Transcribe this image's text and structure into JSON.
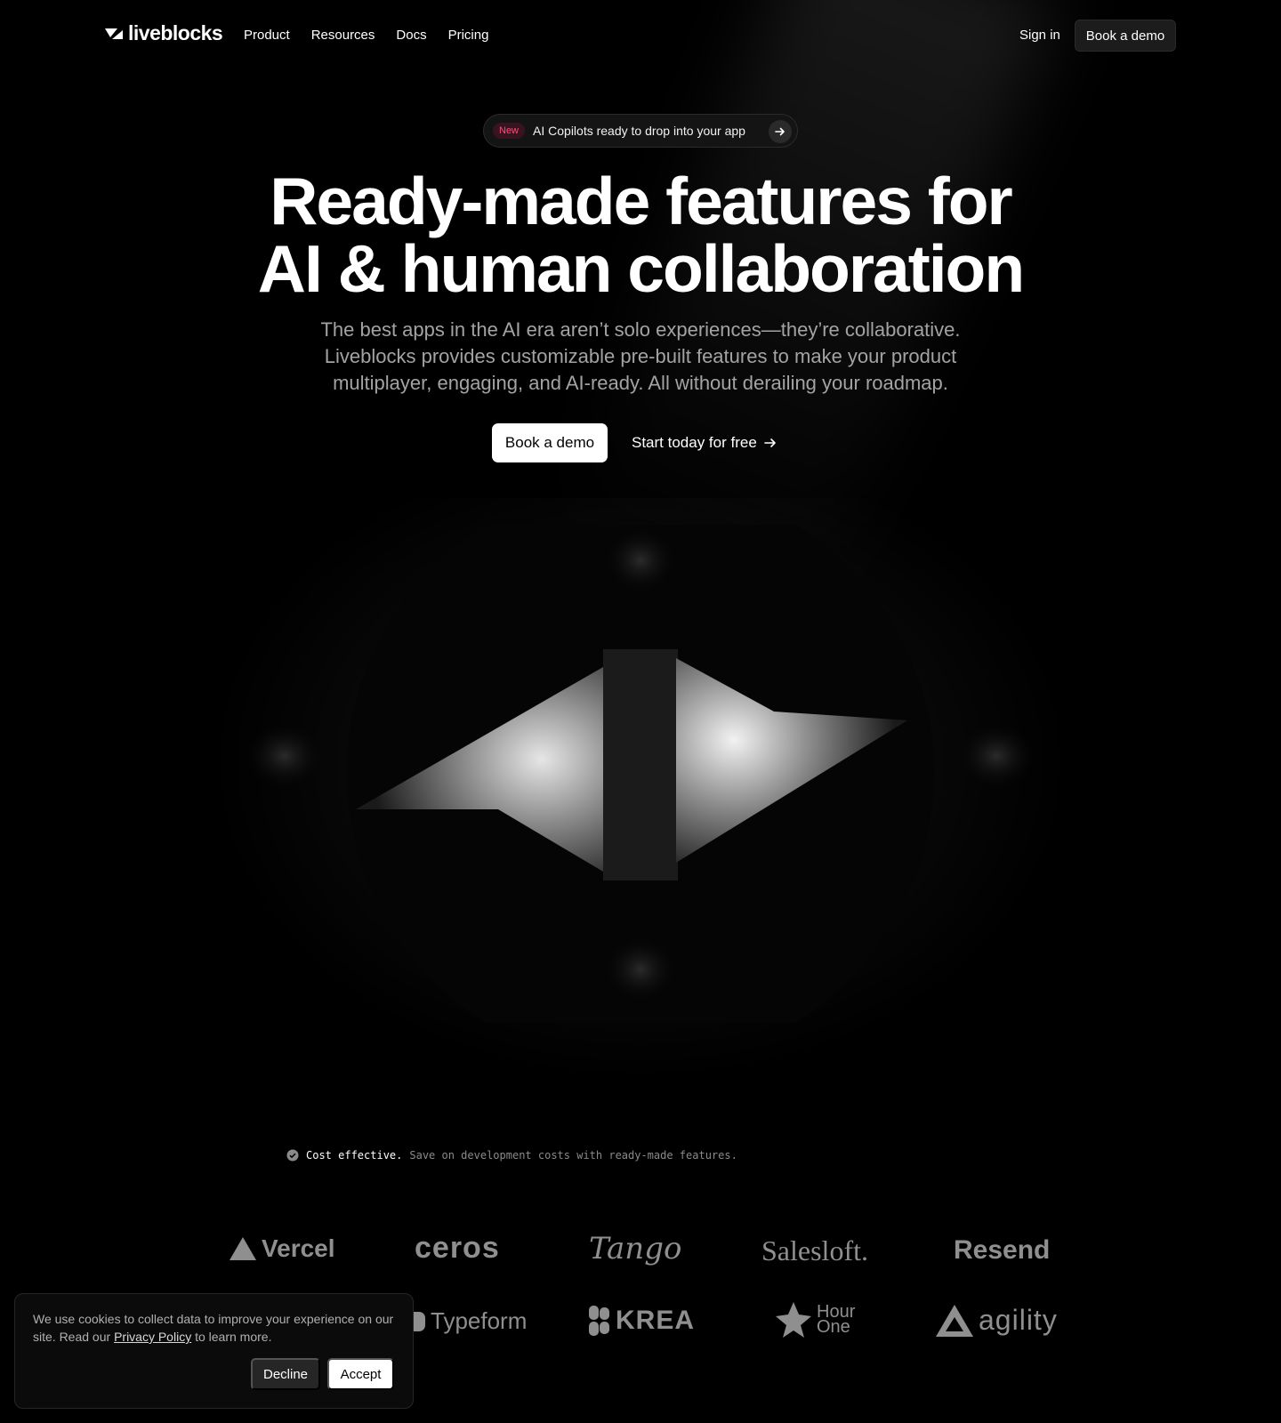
{
  "brand": {
    "name": "liveblocks"
  },
  "nav": {
    "links": [
      "Product",
      "Resources",
      "Docs",
      "Pricing"
    ],
    "signin": "Sign in",
    "cta": "Book a demo"
  },
  "announcement": {
    "badge": "New",
    "text": "AI Copilots ready to drop into your app"
  },
  "hero": {
    "title_line1": "Ready-made features for",
    "title_line2": "AI & human collaboration",
    "subtitle_line1": "The best apps in the AI era aren’t solo experiences—they’re collaborative.",
    "subtitle_line2": "Liveblocks provides customizable pre-built features to make your product",
    "subtitle_line3": "multiplayer, engaging, and AI-ready. All without derailing your roadmap.",
    "primary_cta": "Book a demo",
    "secondary_cta": "Start today for free"
  },
  "highlight": {
    "strong": "Cost effective.",
    "rest": "Save on development costs with ready-made features."
  },
  "customers": {
    "row1": [
      "Vercel",
      "ceros",
      "Tango",
      "Salesloft.",
      "Resend"
    ],
    "row2": [
      "Typeform",
      "KREA",
      "Hour",
      "One",
      "agility"
    ]
  },
  "cookie": {
    "text_before": "We use cookies to collect data to improve your experience on our site. Read our ",
    "link": "Privacy Policy",
    "text_after": " to learn more.",
    "decline": "Decline",
    "accept": "Accept"
  },
  "colors": {
    "background": "#000000",
    "badge_text": "#ff4d7a",
    "badge_bg": "#3a1320",
    "muted_text": "#a3a3a3",
    "logo_gray": "#8f8f8f"
  }
}
